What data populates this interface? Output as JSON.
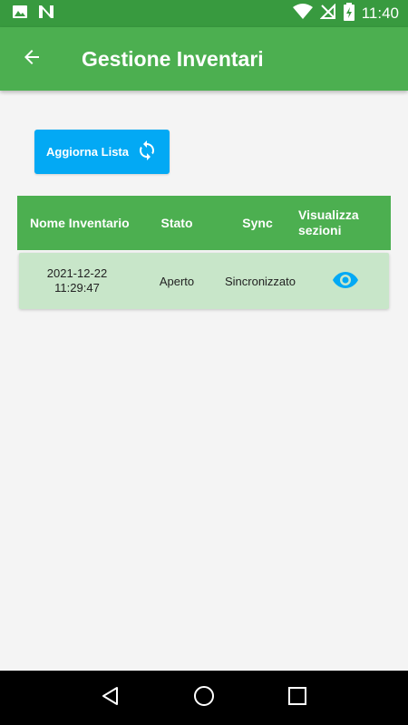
{
  "status_bar": {
    "time": "11:40",
    "left_icons": [
      "image-icon",
      "n-logo-icon"
    ],
    "right_icons": [
      "wifi-icon",
      "no-signal-icon",
      "battery-charging-icon"
    ]
  },
  "app_bar": {
    "title": "Gestione Inventari",
    "back_icon": "arrow-left-icon"
  },
  "refresh_button": {
    "label": "Aggiorna Lista",
    "icon": "sync-icon"
  },
  "table": {
    "headers": [
      "Nome Inventario",
      "Stato",
      "Sync",
      "Visualizza sezioni"
    ],
    "rows": [
      {
        "date": "2021-12-22",
        "time": "11:29:47",
        "stato": "Aperto",
        "sync": "Sincronizzato",
        "view_icon": "eye-icon"
      }
    ]
  },
  "nav_bar": {
    "buttons": [
      "back-triangle-icon",
      "home-circle-icon",
      "recents-square-icon"
    ]
  },
  "colors": {
    "primary": "#4caf50",
    "status_bar": "#389a3f",
    "accent": "#03a9f4",
    "row_bg": "#c8e6c9",
    "background": "#f4f4f4"
  }
}
